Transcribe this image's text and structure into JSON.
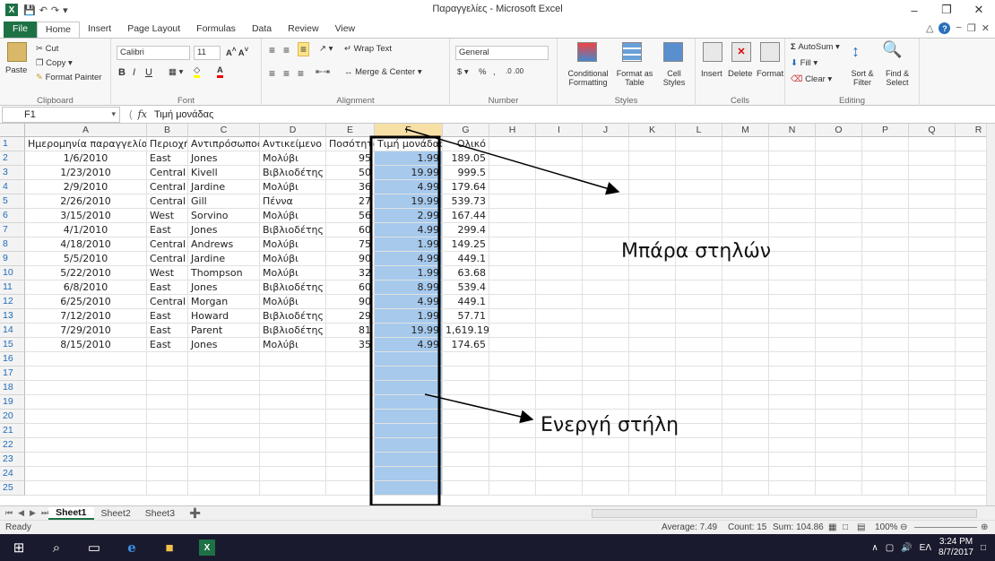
{
  "window": {
    "title": "Παραγγελίες - Microsoft Excel"
  },
  "qat_items": [
    "save-icon",
    "undo-icon",
    "redo-icon",
    "customize-icon"
  ],
  "tabs": [
    "File",
    "Home",
    "Insert",
    "Page Layout",
    "Formulas",
    "Data",
    "Review",
    "View"
  ],
  "ribbon": {
    "clipboard": {
      "paste": "Paste",
      "cut": "Cut",
      "copy": "Copy",
      "format_painter": "Format Painter",
      "label": "Clipboard"
    },
    "font": {
      "name": "Calibri",
      "size": "11",
      "label": "Font"
    },
    "alignment": {
      "wrap": "Wrap Text",
      "merge": "Merge & Center",
      "label": "Alignment"
    },
    "number": {
      "format": "General",
      "label": "Number"
    },
    "styles": {
      "conditional": "Conditional Formatting",
      "format_table": "Format as Table",
      "cell_styles": "Cell Styles",
      "label": "Styles"
    },
    "cells": {
      "insert": "Insert",
      "delete": "Delete",
      "format": "Format",
      "label": "Cells"
    },
    "editing": {
      "autosum": "AutoSum",
      "fill": "Fill",
      "clear": "Clear",
      "sort": "Sort & Filter",
      "find": "Find & Select",
      "label": "Editing"
    }
  },
  "formula_bar": {
    "name_box": "F1",
    "fx": "fx",
    "content": "Τιμή μονάδας"
  },
  "columns": [
    "A",
    "B",
    "C",
    "D",
    "E",
    "F",
    "G",
    "H",
    "I",
    "J",
    "K",
    "L",
    "M",
    "N",
    "O",
    "P",
    "Q",
    "R"
  ],
  "table": {
    "headers": [
      "Ημερομηνία παραγγελίας",
      "Περιοχή",
      "Αντιπρόσωπος",
      "Αντικείμενο",
      "Ποσότητα",
      "Τιμή μονάδας",
      "Ολικό"
    ],
    "rows": [
      [
        "1/6/2010",
        "East",
        "Jones",
        "Μολύβι",
        "95",
        "1.99",
        "189.05"
      ],
      [
        "1/23/2010",
        "Central",
        "Kivell",
        "Βιβλιοδέτης",
        "50",
        "19.99",
        "999.5"
      ],
      [
        "2/9/2010",
        "Central",
        "Jardine",
        "Μολύβι",
        "36",
        "4.99",
        "179.64"
      ],
      [
        "2/26/2010",
        "Central",
        "Gill",
        "Πέννα",
        "27",
        "19.99",
        "539.73"
      ],
      [
        "3/15/2010",
        "West",
        "Sorvino",
        "Μολύβι",
        "56",
        "2.99",
        "167.44"
      ],
      [
        "4/1/2010",
        "East",
        "Jones",
        "Βιβλιοδέτης",
        "60",
        "4.99",
        "299.4"
      ],
      [
        "4/18/2010",
        "Central",
        "Andrews",
        "Μολύβι",
        "75",
        "1.99",
        "149.25"
      ],
      [
        "5/5/2010",
        "Central",
        "Jardine",
        "Μολύβι",
        "90",
        "4.99",
        "449.1"
      ],
      [
        "5/22/2010",
        "West",
        "Thompson",
        "Μολύβι",
        "32",
        "1.99",
        "63.68"
      ],
      [
        "6/8/2010",
        "East",
        "Jones",
        "Βιβλιοδέτης",
        "60",
        "8.99",
        "539.4"
      ],
      [
        "6/25/2010",
        "Central",
        "Morgan",
        "Μολύβι",
        "90",
        "4.99",
        "449.1"
      ],
      [
        "7/12/2010",
        "East",
        "Howard",
        "Βιβλιοδέτης",
        "29",
        "1.99",
        "57.71"
      ],
      [
        "7/29/2010",
        "East",
        "Parent",
        "Βιβλιοδέτης",
        "81",
        "19.99",
        "1,619.19"
      ],
      [
        "8/15/2010",
        "East",
        "Jones",
        "Μολύβι",
        "35",
        "4.99",
        "174.65"
      ]
    ],
    "row_count": 25
  },
  "annotations": {
    "column_header_label": "Μπάρα στηλών",
    "active_column_label": "Ενεργή στήλη"
  },
  "sheets": [
    "Sheet1",
    "Sheet2",
    "Sheet3"
  ],
  "status": {
    "ready": "Ready",
    "average": "Average: 7.49",
    "count": "Count: 15",
    "sum": "Sum: 104.86",
    "zoom": "100%"
  },
  "taskbar": {
    "lang": "ΕΛ",
    "time": "3:24 PM",
    "date": "8/7/2017"
  },
  "colors": {
    "excel_green": "#1e7145",
    "selection": "#a6c9ec",
    "header_selected": "#f7e0a6"
  }
}
